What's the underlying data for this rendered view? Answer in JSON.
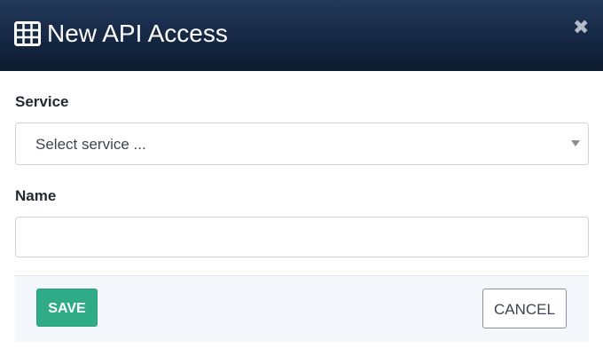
{
  "dialog": {
    "title": "New API Access",
    "header_icon": "table-icon",
    "close_icon": "close-icon",
    "close_glyph": "✖"
  },
  "form": {
    "service": {
      "label": "Service",
      "selected_value": "Select service ...",
      "icon": "caret-down-icon"
    },
    "name": {
      "label": "Name",
      "value": "",
      "placeholder": ""
    }
  },
  "footer": {
    "save_label": "SAVE",
    "cancel_label": "CANCEL"
  },
  "colors": {
    "header_top": "#24395c",
    "header_bottom": "#0d1b30",
    "save_button": "#2fac86",
    "footer_background": "#f4f7fc"
  }
}
